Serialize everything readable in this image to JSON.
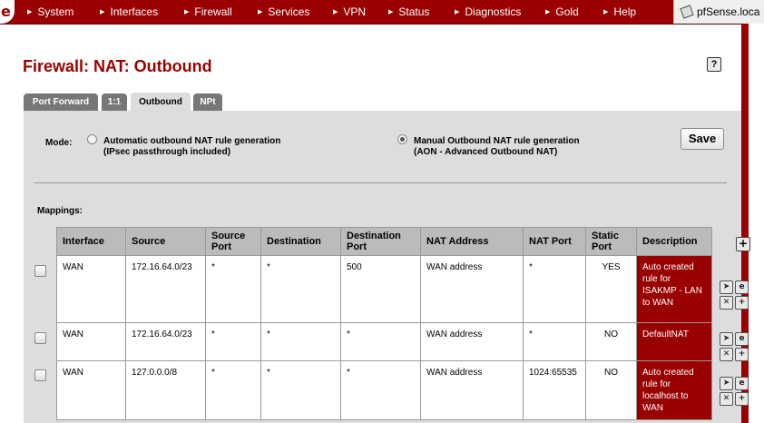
{
  "menu": [
    {
      "label": "System"
    },
    {
      "label": "Interfaces"
    },
    {
      "label": "Firewall"
    },
    {
      "label": "Services"
    },
    {
      "label": "VPN"
    },
    {
      "label": "Status"
    },
    {
      "label": "Diagnostics"
    },
    {
      "label": "Gold"
    },
    {
      "label": "Help"
    }
  ],
  "host": "pfSense.loca",
  "page_title": "Firewall: NAT: Outbound",
  "tabs": [
    {
      "label": "Port Forward",
      "active": false
    },
    {
      "label": "1:1",
      "active": false
    },
    {
      "label": "Outbound",
      "active": true
    },
    {
      "label": "NPt",
      "active": false
    }
  ],
  "mode": {
    "label": "Mode:",
    "auto_line1": "Automatic outbound NAT rule generation",
    "auto_line2": "(IPsec passthrough included)",
    "manual_line1": "Manual Outbound NAT rule generation",
    "manual_line2": "(AON - Advanced Outbound NAT)",
    "selected": "manual"
  },
  "save_label": "Save",
  "mappings_label": "Mappings:",
  "table": {
    "headers": {
      "interface": "Interface",
      "source": "Source",
      "source_port": "Source Port",
      "destination": "Destination",
      "destination_port": "Destination Port",
      "nat_address": "NAT Address",
      "nat_port": "NAT Port",
      "static_port": "Static Port",
      "description": "Description"
    },
    "rows": [
      {
        "interface": "WAN",
        "source": "172.16.64.0/23",
        "source_port": "*",
        "destination": "*",
        "destination_port": "500",
        "nat_address": "WAN address",
        "nat_port": "*",
        "static_port": "YES",
        "description": "Auto created rule for ISAKMP - LAN to WAN"
      },
      {
        "interface": "WAN",
        "source": "172.16.64.0/23",
        "source_port": "*",
        "destination": "*",
        "destination_port": "*",
        "nat_address": "WAN address",
        "nat_port": "*",
        "static_port": "NO",
        "description": "DefaultNAT"
      },
      {
        "interface": "WAN",
        "source": "127.0.0.0/8",
        "source_port": "*",
        "destination": "*",
        "destination_port": "*",
        "nat_address": "WAN address",
        "nat_port": "1024:65535",
        "static_port": "NO",
        "description": "Auto created rule for localhost to WAN"
      }
    ]
  },
  "icons": {
    "add": "plus-icon",
    "move": "move-icon",
    "edit": "edit-icon",
    "delete": "delete-icon",
    "add_row": "add-row-icon"
  },
  "colors": {
    "brand": "#990000",
    "panel": "#dddddd",
    "header": "#bbbbbb"
  }
}
